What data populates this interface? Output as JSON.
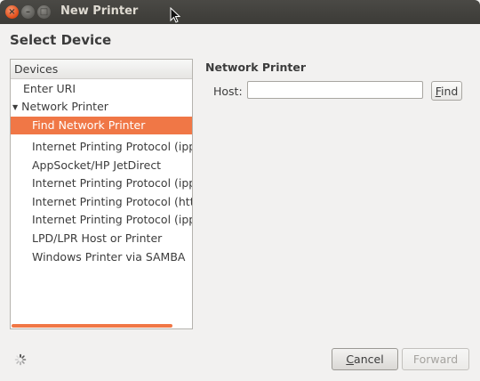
{
  "window": {
    "title": "New Printer"
  },
  "heading": "Select Device",
  "devices": {
    "header": "Devices",
    "items": [
      {
        "label": "Enter URI"
      },
      {
        "label": "Network Printer"
      },
      {
        "label": "Find Network Printer"
      },
      {
        "label": "Internet Printing Protocol (ipp"
      },
      {
        "label": "AppSocket/HP JetDirect"
      },
      {
        "label": "Internet Printing Protocol (ipp"
      },
      {
        "label": "Internet Printing Protocol (htt"
      },
      {
        "label": "Internet Printing Protocol (ipp"
      },
      {
        "label": "LPD/LPR Host or Printer"
      },
      {
        "label": "Windows Printer via SAMBA"
      }
    ]
  },
  "network_printer": {
    "title": "Network Printer",
    "host_label": "Host:",
    "host_value": "",
    "find_prefix": "F",
    "find_rest": "ind"
  },
  "buttons": {
    "cancel_prefix": "C",
    "cancel_rest": "ancel",
    "forward": "Forward"
  },
  "colors": {
    "accent": "#f07746",
    "titlebar": "#3c3b37",
    "close": "#df4a16"
  }
}
